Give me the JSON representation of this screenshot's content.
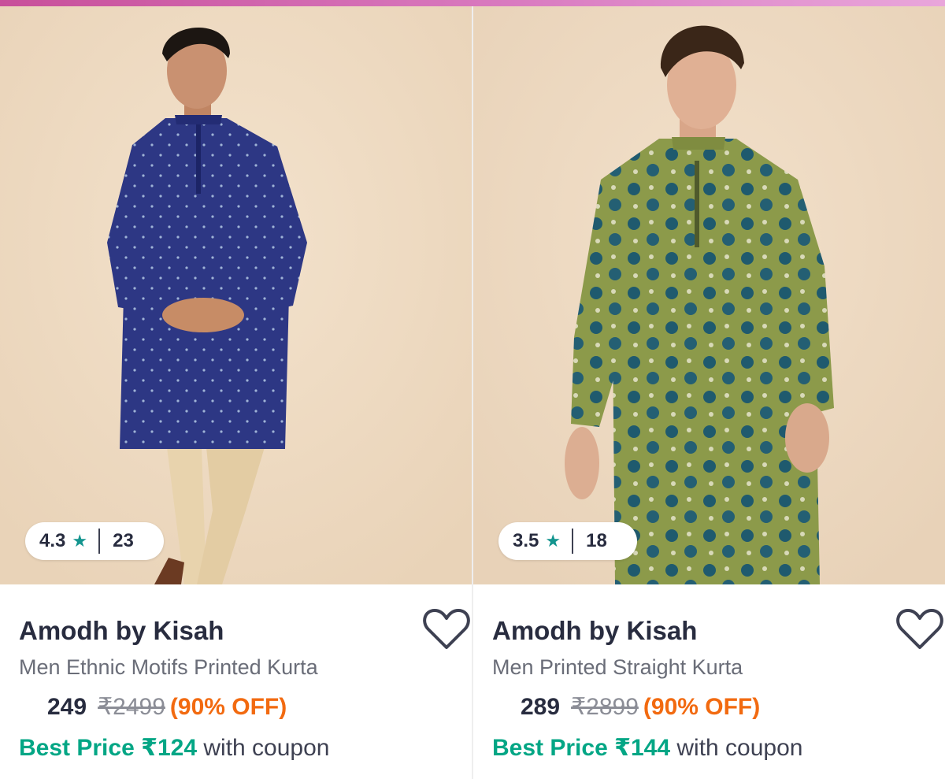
{
  "colors": {
    "accent_bar": "#d97bc0",
    "rating_star": "#14958f",
    "discount": "#f26a10",
    "best_price": "#03a685",
    "photo_background": "#efdcc4"
  },
  "products": [
    {
      "rating": "4.3",
      "rating_icon": "star-icon",
      "rating_count": "23",
      "brand": "Amodh by Kisah",
      "name": "Men Ethnic Motifs Printed Kurta",
      "price": "249",
      "mrp": "₹2499",
      "discount": "(90% OFF)",
      "best_price_label": "Best Price ₹124",
      "coupon_text": "with coupon",
      "wishlist_icon": "heart-outline-icon",
      "image_icon": "model-in-navy-kurta-photo"
    },
    {
      "rating": "3.5",
      "rating_icon": "star-icon",
      "rating_count": "18",
      "brand": "Amodh by Kisah",
      "name": "Men Printed Straight Kurta",
      "price": "289",
      "mrp": "₹2899",
      "discount": "(90% OFF)",
      "best_price_label": "Best Price ₹144",
      "coupon_text": "with coupon",
      "wishlist_icon": "heart-outline-icon",
      "image_icon": "model-in-green-kurta-photo"
    }
  ]
}
